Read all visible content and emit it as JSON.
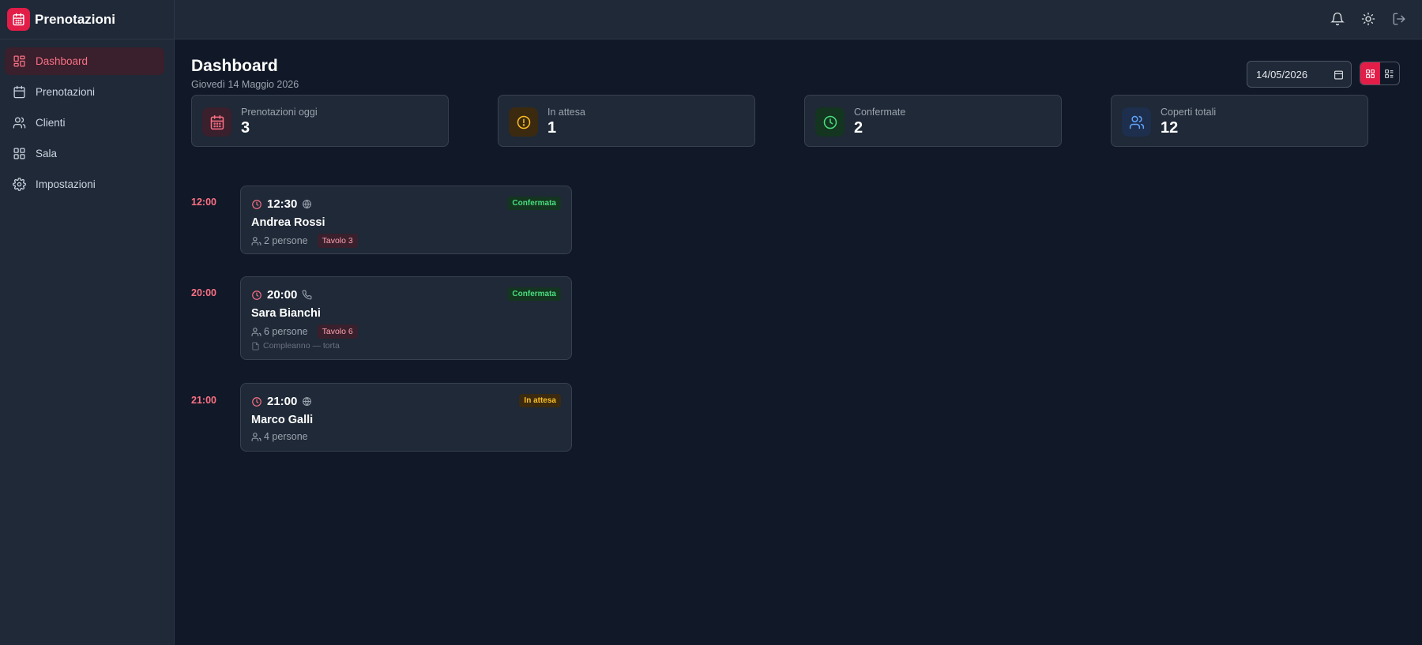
{
  "brand": {
    "title": "Prenotazioni"
  },
  "sidebar": {
    "items": [
      {
        "label": "Dashboard",
        "icon": "dashboard-icon",
        "active": true
      },
      {
        "label": "Prenotazioni",
        "icon": "calendar-icon",
        "active": false
      },
      {
        "label": "Clienti",
        "icon": "users-icon",
        "active": false
      },
      {
        "label": "Sala",
        "icon": "grid-icon",
        "active": false
      },
      {
        "label": "Impostazioni",
        "icon": "gear-icon",
        "active": false
      }
    ]
  },
  "topbar": {
    "icons": [
      "bell-icon",
      "sun-icon",
      "logout-icon"
    ]
  },
  "header": {
    "title": "Dashboard",
    "subtitle": "Giovedì 14 Maggio 2026"
  },
  "date_picker": {
    "value": "14/05/2026"
  },
  "view_toggle": {
    "selected": "grid",
    "options": [
      "grid-view-icon",
      "list-view-icon"
    ]
  },
  "stats": [
    {
      "label": "Prenotazioni oggi",
      "value": "3",
      "icon": "calendar-icon",
      "color": "#fb7185"
    },
    {
      "label": "In attesa",
      "value": "1",
      "icon": "alert-circle-icon",
      "color": "#fbbf24"
    },
    {
      "label": "Confermate",
      "value": "2",
      "icon": "clock-icon",
      "color": "#4ade80"
    },
    {
      "label": "Coperti totali",
      "value": "12",
      "icon": "users-icon",
      "color": "#60a5fa"
    }
  ],
  "reservations": [
    {
      "slot": "12:00",
      "time": "12:30",
      "source": "globe-icon",
      "name": "Andrea Rossi",
      "guests": "2 persone",
      "table": "Tavolo 3",
      "status": "Confermata",
      "note": ""
    },
    {
      "slot": "20:00",
      "time": "20:00",
      "source": "phone-icon",
      "name": "Sara Bianchi",
      "guests": "6 persone",
      "table": "Tavolo 6",
      "status": "Confermata",
      "note": "Compleanno — torta"
    },
    {
      "slot": "21:00",
      "time": "21:00",
      "source": "globe-icon",
      "name": "Marco Galli",
      "guests": "4 persone",
      "table": "",
      "status": "In attesa",
      "note": ""
    }
  ],
  "colors": {
    "accent": "#e11d48",
    "background": "#111827",
    "panel": "#1f2937"
  }
}
